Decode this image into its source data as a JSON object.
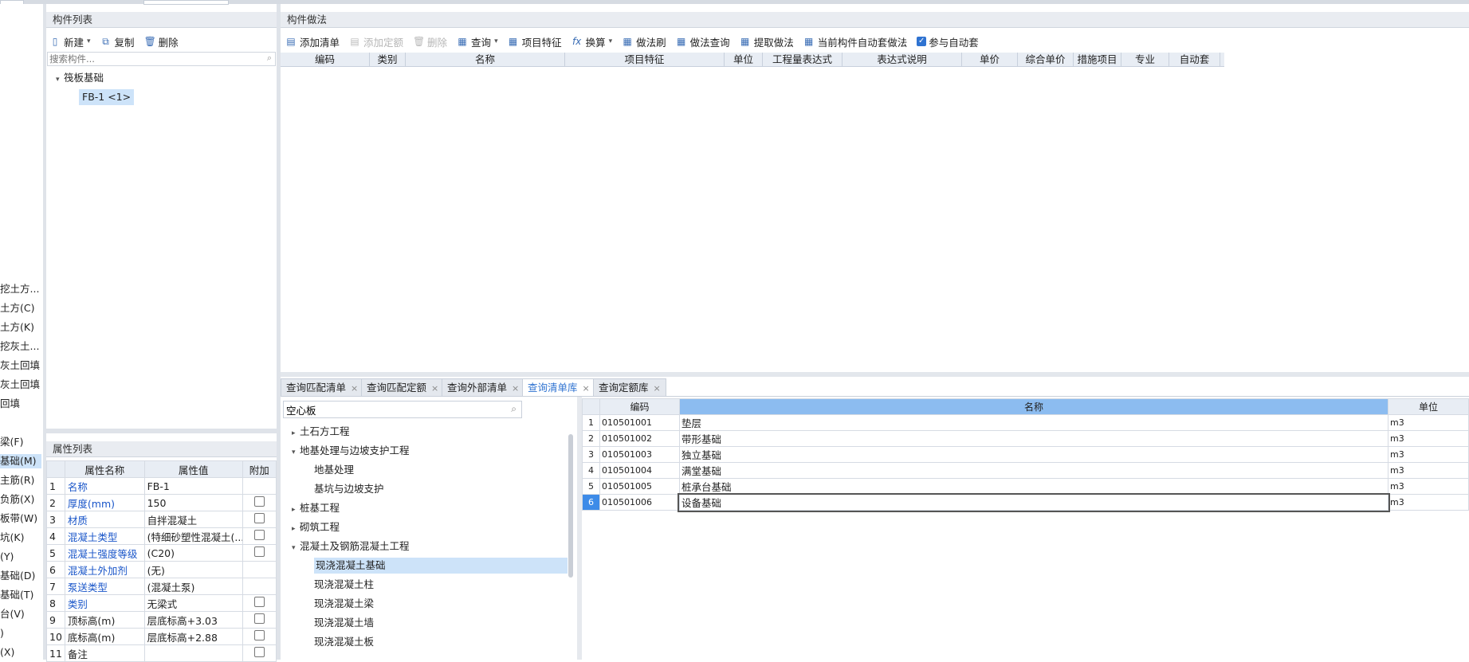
{
  "left_strip": [
    "挖土方...",
    "土方(C)",
    "土方(K)",
    "挖灰土...",
    "灰土回填",
    "灰土回填",
    "回填",
    "梁(F)",
    "基础(M)",
    "主筋(R)",
    "负筋(X)",
    "板带(W)",
    "坑(K)",
    "(Y)",
    "基础(D)",
    "基础(T)",
    "台(V)",
    ")",
    "(X)"
  ],
  "component_list": {
    "title": "构件列表",
    "new_label": "新建",
    "copy_label": "复制",
    "delete_label": "删除",
    "search_placeholder": "搜索构件...",
    "tree_root": "筏板基础",
    "tree_child": "FB-1 <1>"
  },
  "property_list": {
    "title": "属性列表",
    "headers": [
      "属性名称",
      "属性值",
      "附加"
    ],
    "rows": [
      {
        "no": "1",
        "name": "名称",
        "value": "FB-1",
        "blue": true,
        "check": false
      },
      {
        "no": "2",
        "name": "厚度(mm)",
        "value": "150",
        "blue": true,
        "check": true
      },
      {
        "no": "3",
        "name": "材质",
        "value": "自拌混凝土",
        "blue": true,
        "check": true
      },
      {
        "no": "4",
        "name": "混凝土类型",
        "value": "(特细砂塑性混凝土(...",
        "blue": true,
        "check": true
      },
      {
        "no": "5",
        "name": "混凝土强度等级",
        "value": "(C20)",
        "blue": true,
        "check": true
      },
      {
        "no": "6",
        "name": "混凝土外加剂",
        "value": "(无)",
        "blue": true,
        "check": false
      },
      {
        "no": "7",
        "name": "泵送类型",
        "value": "(混凝土泵)",
        "blue": true,
        "check": false
      },
      {
        "no": "8",
        "name": "类别",
        "value": "无梁式",
        "blue": true,
        "check": true
      },
      {
        "no": "9",
        "name": "顶标高(m)",
        "value": "层底标高+3.03",
        "blue": false,
        "check": true
      },
      {
        "no": "10",
        "name": "底标高(m)",
        "value": "层底标高+2.88",
        "blue": false,
        "check": true
      },
      {
        "no": "11",
        "name": "备注",
        "value": "",
        "blue": false,
        "check": true
      }
    ]
  },
  "method": {
    "title": "构件做法",
    "toolbar": {
      "add_list": "添加清单",
      "add_quota": "添加定额",
      "delete": "删除",
      "query": "查询",
      "item_feature": "项目特征",
      "convert": "换算",
      "method_brush": "做法刷",
      "method_query": "做法查询",
      "extract": "提取做法",
      "auto_apply": "当前构件自动套做法",
      "participate": "参与自动套"
    },
    "columns": [
      "编码",
      "类别",
      "名称",
      "项目特征",
      "单位",
      "工程量表达式",
      "表达式说明",
      "单价",
      "综合单价",
      "措施项目",
      "专业",
      "自动套"
    ]
  },
  "bottom_tabs": [
    "查询匹配清单",
    "查询匹配定额",
    "查询外部清单",
    "查询清单库",
    "查询定额库"
  ],
  "query": {
    "search_value": "空心板",
    "tree": [
      {
        "label": "土石方工程",
        "arrow": "▸",
        "level": 0
      },
      {
        "label": "地基处理与边坡支护工程",
        "arrow": "▾",
        "level": 0
      },
      {
        "label": "地基处理",
        "arrow": "",
        "level": 1
      },
      {
        "label": "基坑与边坡支护",
        "arrow": "",
        "level": 1
      },
      {
        "label": "桩基工程",
        "arrow": "▸",
        "level": 0
      },
      {
        "label": "砌筑工程",
        "arrow": "▸",
        "level": 0
      },
      {
        "label": "混凝土及钢筋混凝土工程",
        "arrow": "▾",
        "level": 0
      },
      {
        "label": "现浇混凝土基础",
        "arrow": "",
        "level": 1
      },
      {
        "label": "现浇混凝土柱",
        "arrow": "",
        "level": 1
      },
      {
        "label": "现浇混凝土梁",
        "arrow": "",
        "level": 1
      },
      {
        "label": "现浇混凝土墙",
        "arrow": "",
        "level": 1
      },
      {
        "label": "现浇混凝土板",
        "arrow": "",
        "level": 1
      }
    ],
    "result_headers": [
      "编码",
      "名称",
      "单位"
    ],
    "results": [
      {
        "no": "1",
        "code": "010501001",
        "name": "垫层",
        "unit": "m3"
      },
      {
        "no": "2",
        "code": "010501002",
        "name": "带形基础",
        "unit": "m3"
      },
      {
        "no": "3",
        "code": "010501003",
        "name": "独立基础",
        "unit": "m3"
      },
      {
        "no": "4",
        "code": "010501004",
        "name": "满堂基础",
        "unit": "m3"
      },
      {
        "no": "5",
        "code": "010501005",
        "name": "桩承台基础",
        "unit": "m3"
      },
      {
        "no": "6",
        "code": "010501006",
        "name": "设备基础",
        "unit": "m3"
      }
    ]
  }
}
